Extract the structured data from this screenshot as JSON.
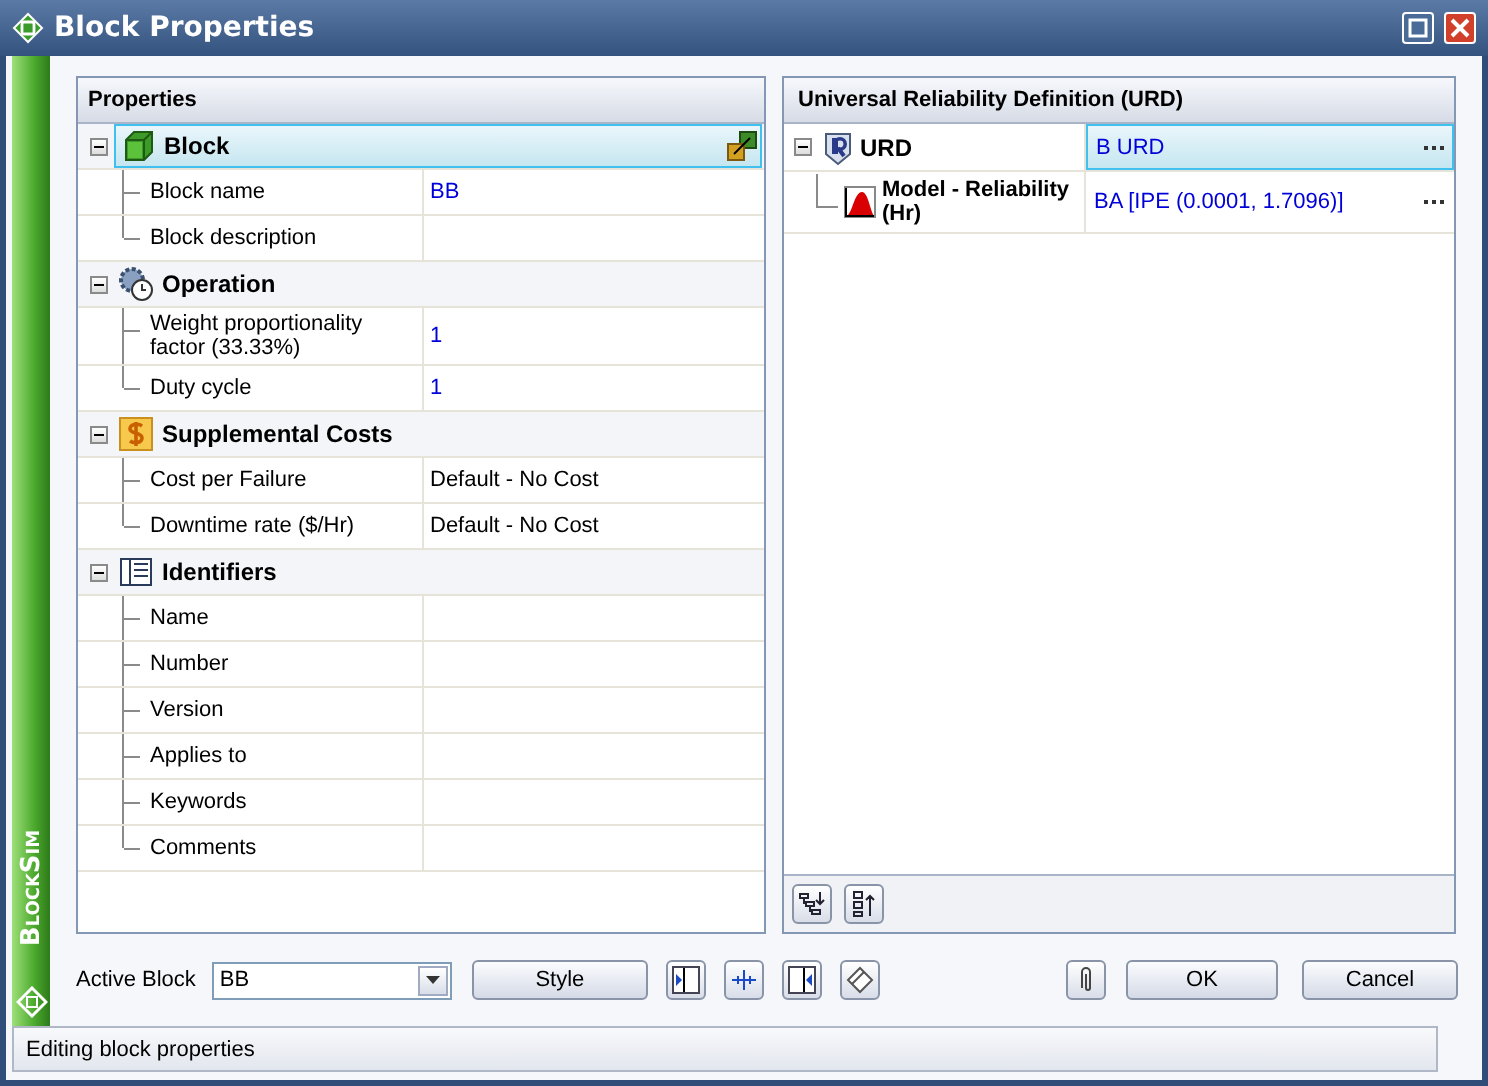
{
  "window": {
    "title": "Block Properties",
    "brand": "BlockSim"
  },
  "properties": {
    "title": "Properties",
    "categories": [
      {
        "label": "Block",
        "expanded": true,
        "selected": true,
        "rows": [
          {
            "name": "Block name",
            "value": "BB",
            "modified": true
          },
          {
            "name": "Block description"
          }
        ]
      },
      {
        "label": "Operation",
        "expanded": true,
        "selected": false,
        "rows": [
          {
            "name": "Weight proportionality factor (33.33%)",
            "value": "1",
            "modified": true
          },
          {
            "name": "Duty cycle",
            "value": "1",
            "modified": true
          }
        ]
      },
      {
        "label": "Supplemental Costs",
        "expanded": true,
        "selected": false,
        "rows": [
          {
            "name": "Cost per Failure",
            "value": "Default - No Cost",
            "modified": false
          },
          {
            "name": "Downtime rate ($/Hr)",
            "value": "Default - No Cost",
            "modified": false
          }
        ]
      },
      {
        "label": "Identifiers",
        "expanded": true,
        "selected": false,
        "rows": [
          {
            "name": "Name"
          },
          {
            "name": "Number"
          },
          {
            "name": "Version"
          },
          {
            "name": "Applies to"
          },
          {
            "name": "Keywords"
          },
          {
            "name": "Comments"
          }
        ]
      }
    ]
  },
  "urd": {
    "title": "Universal Reliability Definition (URD)",
    "items": [
      {
        "label": "URD",
        "value": "B URD",
        "expanded": true,
        "selected": true,
        "children": [
          {
            "label": "Model - Reliability (Hr)",
            "value": "BA [IPE (0.0001, 1.7096)]",
            "selected": false
          }
        ]
      }
    ]
  },
  "footer": {
    "active_block_label": "Active Block",
    "active_block": "BB",
    "style_button": "Style",
    "ok_button": "OK",
    "cancel_button": "Cancel"
  },
  "status_bar": "Editing block properties"
}
